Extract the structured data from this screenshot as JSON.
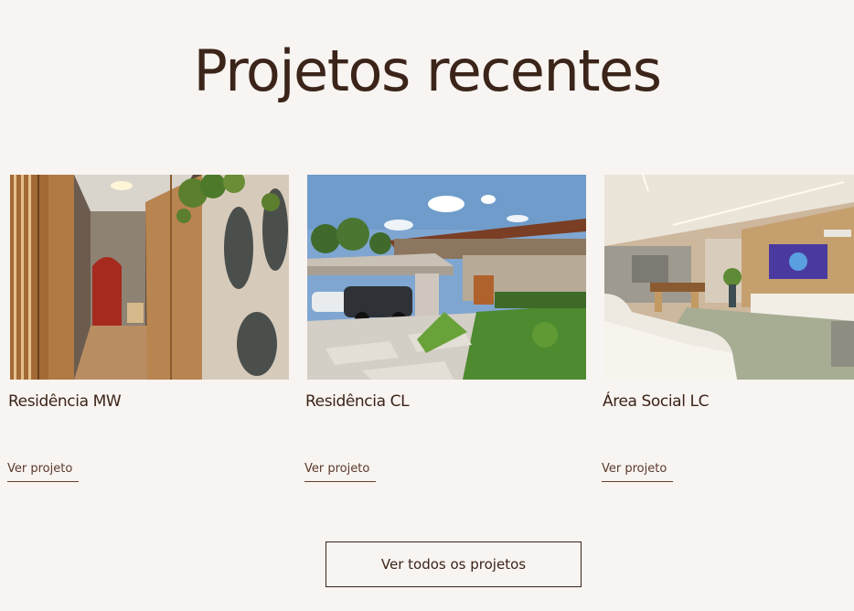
{
  "section": {
    "title": "Projetos recentes",
    "view_all_label": "Ver todos os projetos"
  },
  "projects": [
    {
      "name": "Residência MW",
      "link_label": "Ver projeto"
    },
    {
      "name": "Residência CL",
      "link_label": "Ver projeto"
    },
    {
      "name": "Área Social LC",
      "link_label": "Ver projeto"
    }
  ],
  "colors": {
    "background": "#f8f4f1",
    "text": "#3b2419",
    "underline": "#6e3b28"
  }
}
